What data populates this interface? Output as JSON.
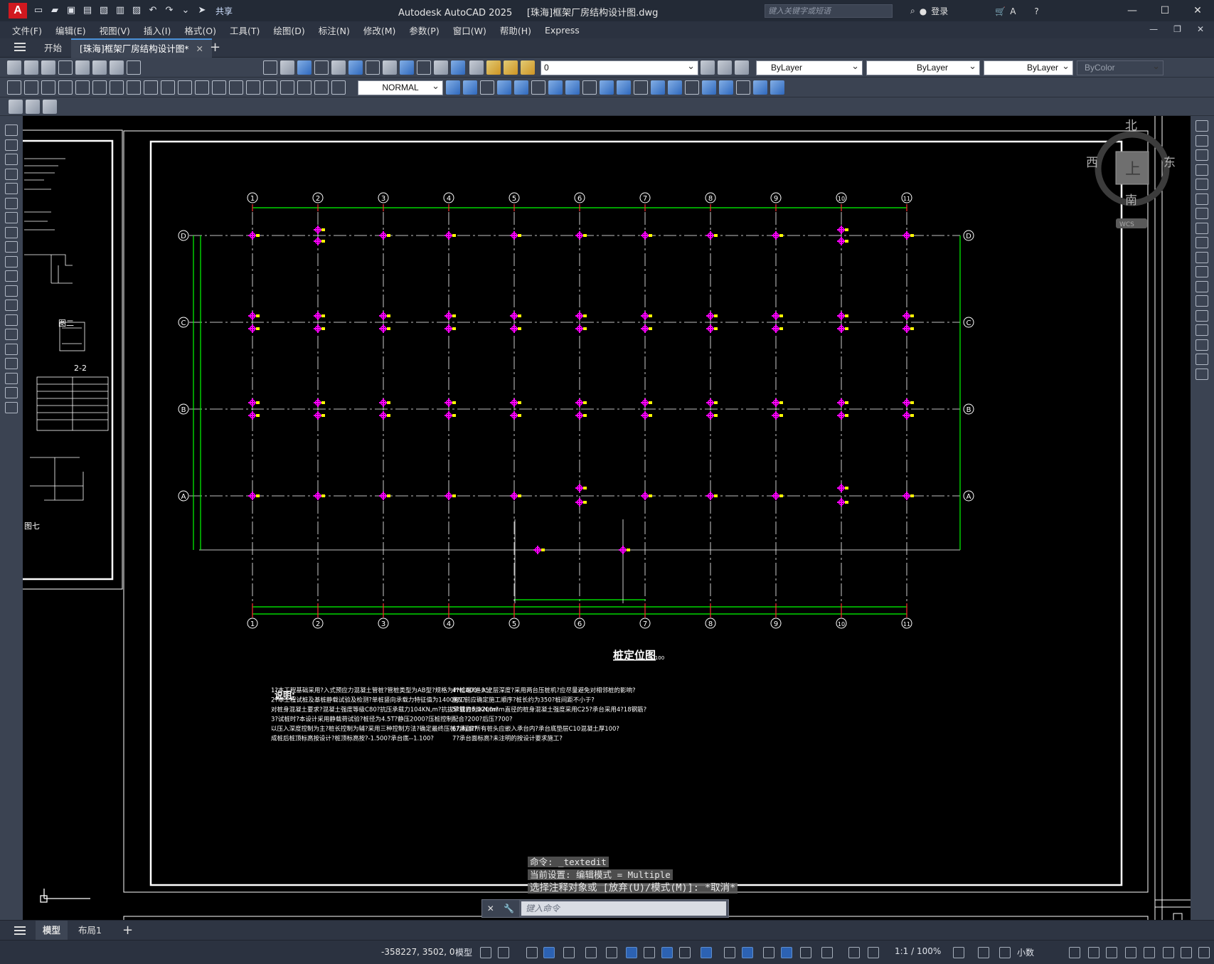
{
  "app": {
    "logo": "A",
    "title": "Autodesk AutoCAD 2025",
    "document": "[珠海]框架厂房结构设计图.dwg",
    "share_label": "共享"
  },
  "search": {
    "placeholder": "键入关键字或短语"
  },
  "account": {
    "login_label": "登录"
  },
  "menu": [
    "文件(F)",
    "编辑(E)",
    "视图(V)",
    "插入(I)",
    "格式(O)",
    "工具(T)",
    "绘图(D)",
    "标注(N)",
    "修改(M)",
    "参数(P)",
    "窗口(W)",
    "帮助(H)",
    "Express"
  ],
  "tabs": [
    {
      "label": "开始"
    },
    {
      "label": "[珠海]框架厂房结构设计图*"
    }
  ],
  "properties": {
    "layer": "0",
    "color": "ByLayer",
    "linetype": "ByLayer",
    "lineweight": "ByLayer",
    "plotstyle": "ByColor",
    "text_style": "NORMAL"
  },
  "viewcube": {
    "north": "北",
    "south": "南",
    "east": "东",
    "west": "西",
    "face": "上",
    "wcs": "WCS"
  },
  "drawing": {
    "axis_numbers": [
      "1",
      "2",
      "3",
      "4",
      "5",
      "6",
      "7",
      "8",
      "9",
      "10",
      "11"
    ],
    "axis_letters": [
      "D",
      "C",
      "B",
      "A"
    ],
    "plan_title": "桩定位图",
    "plan_scale": "1:100",
    "notes_title": "说明:",
    "notes_left": [
      "1?本工程基础采用?入式预应力混凝土管桩?管桩类型为AB型?规格为PHC400--95?",
      "2?本工程试桩及基桩静载试验及检测?单桩竖向承载力特征值为1400KN?",
      "   对桩身混凝土要求?混凝土强度等级C80?抗压承载力104KN,m?抗拔承载力63KN,m?",
      "3?试桩时?本设计采用静载荷试验?桩径为4.5T?静压2000?压桩控制",
      "   以压入深度控制为主?桩长控制为辅?采用三种控制方法?确定最终压桩力标准?",
      "   成桩后桩顶标高按设计?桩顶标高按?-1.500?承台底--1.100?"
    ],
    "notes_right": [
      "4?桩端?进入土层深度?采用两台压桩机?应尽量避免对相邻桩的影响?",
      "   施工前应确定施工顺序?桩长约为350?桩间距不小于?",
      "5?管桩为1200mm直径的桩身混凝土强度采用C25?承台采用4?18钢筋?",
      "   配合?200?后压?700?",
      "6?承台?所有桩头应嵌入承台内?承台底垫层C10混凝土厚100?",
      "7?承台面标高?未注明的按设计要求施工?"
    ],
    "sheet_left": {
      "label_2": "图二",
      "label_22": "2-2",
      "label_7": "图七"
    }
  },
  "command": {
    "history": [
      "命令: _textedit",
      "当前设置: 编辑模式 = Multiple",
      "选择注释对象或 [放弃(U)/模式(M)]: *取消*"
    ],
    "placeholder": "键入命令"
  },
  "layouts": [
    {
      "label": "模型"
    },
    {
      "label": "布局1"
    }
  ],
  "status": {
    "coords": "-358227, 3502, 0",
    "model_label": "模型",
    "scale": "1:1 / 100%",
    "units": "小数"
  },
  "colors": {
    "grid_line": "#ffffff",
    "pile": "#ff00ff",
    "dim": "#00ff00",
    "marker": "#ffff00",
    "frame": "#ffffff",
    "bg": "#000000"
  }
}
